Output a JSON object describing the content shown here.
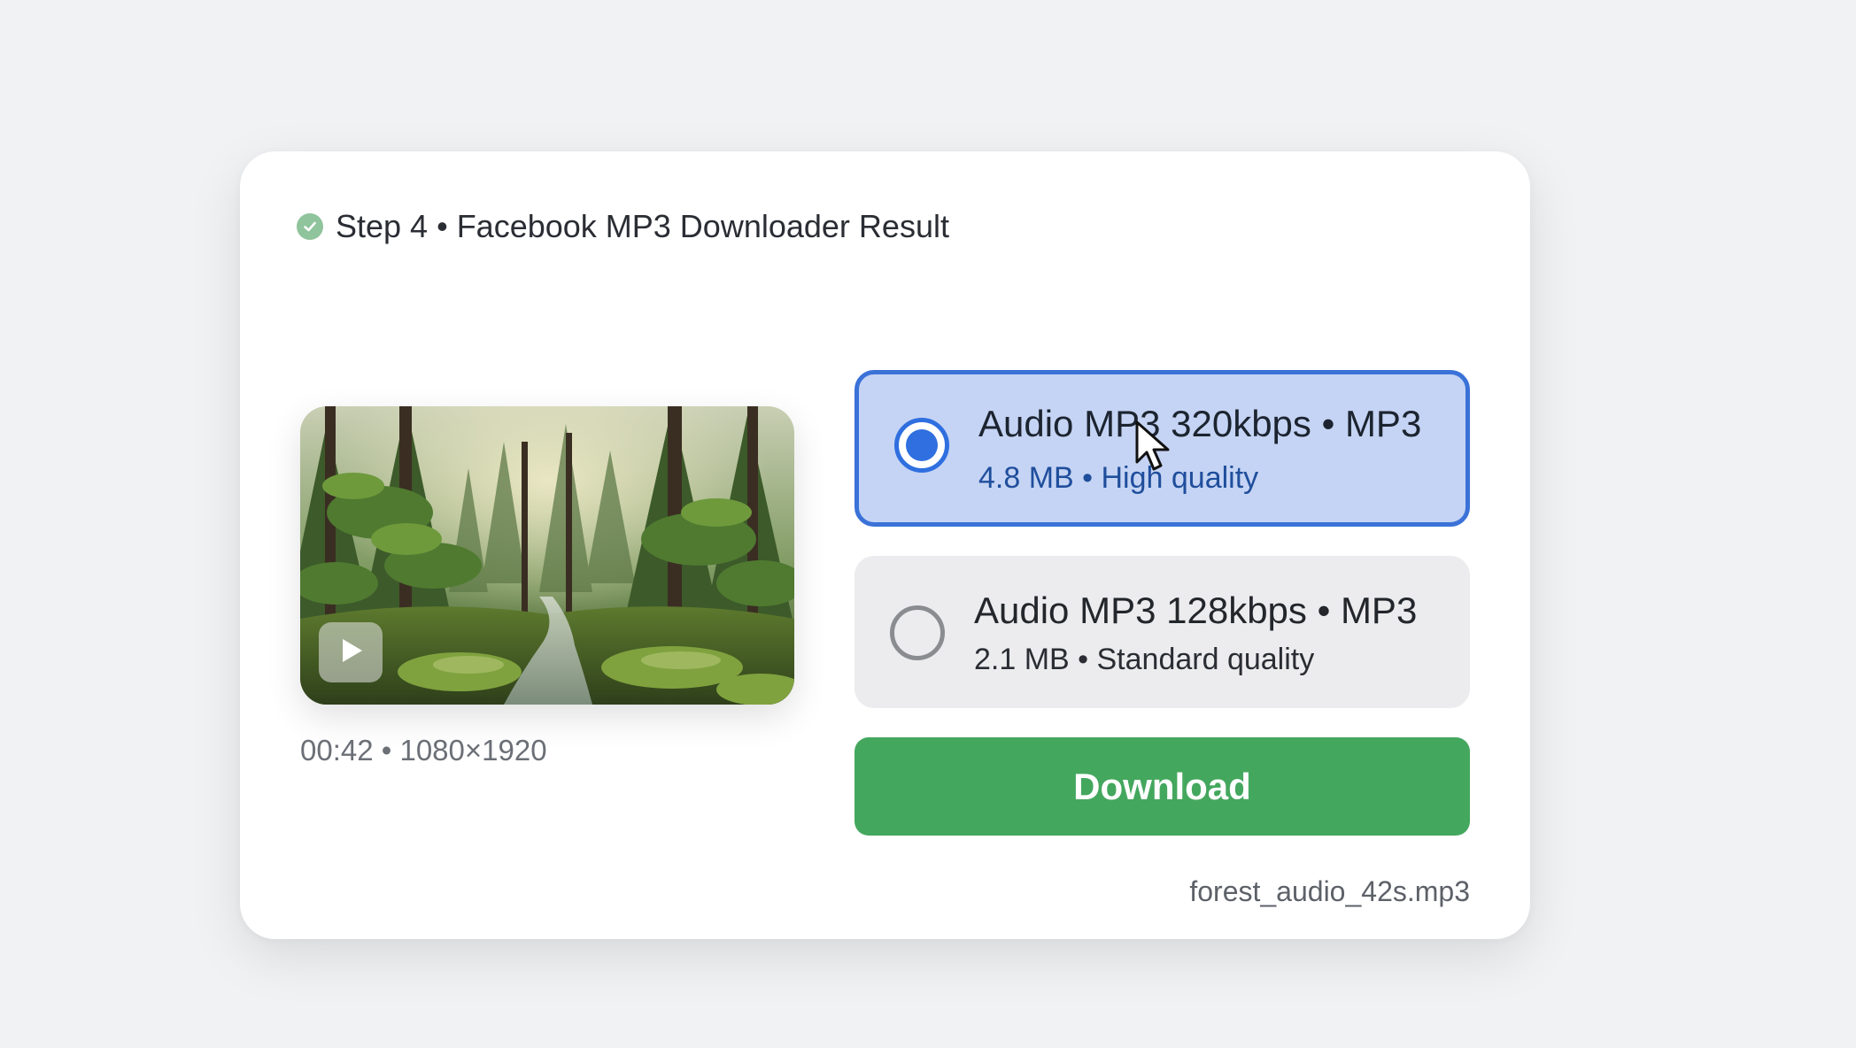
{
  "header": {
    "title": "Step 4 • Facebook MP3 Downloader Result"
  },
  "video": {
    "meta": "00:42 • 1080×1920"
  },
  "options": [
    {
      "title": "Audio MP3 320kbps • MP3",
      "subtitle": "4.8 MB • High quality",
      "selected": true
    },
    {
      "title": "Audio MP3 128kbps • MP3",
      "subtitle": "2.1 MB • Standard quality",
      "selected": false
    }
  ],
  "download": {
    "label": "Download",
    "filename": "forest_audio_42s.mp3"
  },
  "colors": {
    "accent": "#2f6fdf",
    "selected_bg": "#c5d4f4",
    "download_green": "#44a75e",
    "check_green": "#8fc49c"
  },
  "icons": [
    "check-circle-icon",
    "play-icon",
    "radio-selected-icon",
    "radio-unselected-icon",
    "mouse-cursor-icon"
  ]
}
